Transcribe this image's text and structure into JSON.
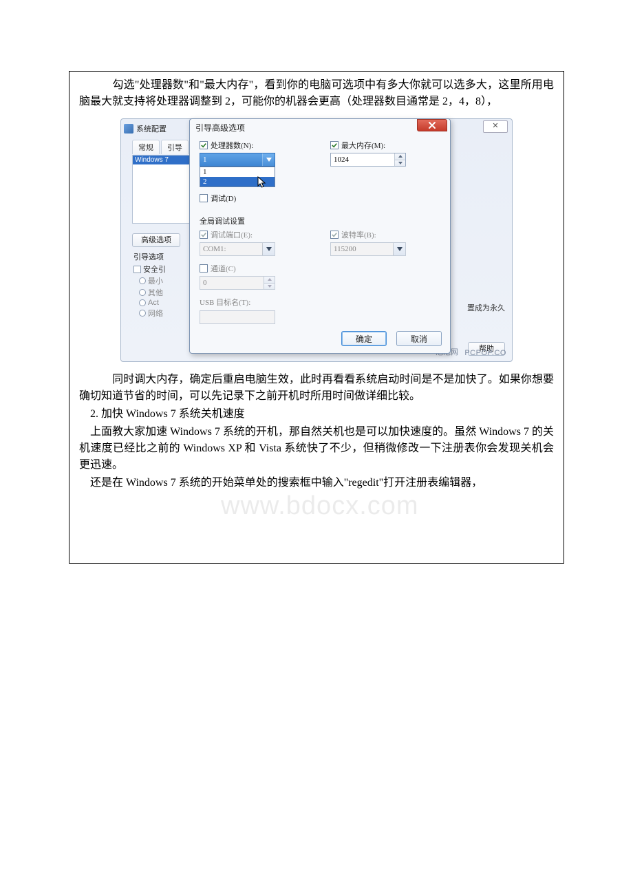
{
  "document": {
    "para1": "　　　勾选\"处理器数\"和\"最大内存\"，看到你的电脑可选项中有多大你就可以选多大，这里所用电脑最大就支持将处理器调整到 2，可能你的机器会更高（处理器数目通常是 2，4，8），",
    "para2": "　　　同时调大内存，确定后重启电脑生效，此时再看看系统启动时间是不是加快了。如果你想要确切知道节省的时间，可以先记录下之前开机时所用时间做详细比较。",
    "para_spacer": " ",
    "para3": "　2. 加快 Windows 7 系统关机速度",
    "para4": "　上面教大家加速 Windows 7 系统的开机，那自然关机也是可以加快速度的。虽然 Windows 7 的关机速度已经比之前的 Windows XP 和 Vista 系统快了不少，但稍微修改一下注册表你会发现关机会更迅速。",
    "para5": "　还是在 Windows 7 系统的开始菜单处的搜索框中输入\"regedit\"打开注册表编辑器，",
    "watermark": "www.bdocx.com"
  },
  "bg_window": {
    "title": "系统配置",
    "tabs": {
      "general": "常规",
      "boot": "引导"
    },
    "list_selected": "Windows 7",
    "adv_btn": "高级选项",
    "boot_options_label": "引导选项",
    "safe_boot": "安全引",
    "radio_min": "最小",
    "radio_other": "其他",
    "radio_act": "Act",
    "radio_net": "网络",
    "set_permanent": "置成为永久",
    "help": "帮助",
    "close_mark": "✕"
  },
  "fg_dialog": {
    "title": "引导高级选项",
    "processors_label": "处理器数(N):",
    "processors_value": "1",
    "processors_options": {
      "opt1": "1",
      "opt2": "2"
    },
    "max_mem_label": "最大内存(M):",
    "max_mem_value": "1024",
    "debug_label": "调试(D)",
    "global_debug_label": "全局调试设置",
    "debug_port_label": "调试端口(E):",
    "debug_port_value": "COM1:",
    "baud_label": "波特率(B):",
    "baud_value": "115200",
    "channel_label": "通道(C)",
    "channel_value": "0",
    "usb_target_label": "USB 目标名(T):",
    "ok": "确定",
    "cancel": "取消"
  },
  "footer": {
    "paopao": "泡泡网",
    "pcpop": "PCPOP.CO"
  }
}
